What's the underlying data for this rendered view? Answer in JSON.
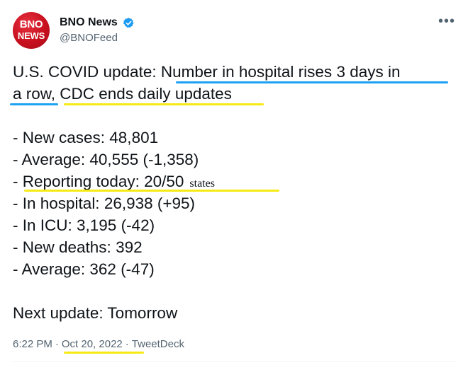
{
  "author": {
    "name": "BNO News",
    "handle": "@BNOFeed",
    "avatar_line1": "BNO",
    "avatar_line2": "NEWS",
    "verified_icon": "verified-badge-icon"
  },
  "more_icon": "more-horizontal-icon",
  "tweet": {
    "headline_part1": "U.S. COVID update: Number in hospital rises 3 days in",
    "headline_part2": "a row, CDC ends daily updates",
    "lines": [
      "- New cases: 48,801",
      "- Average: 40,555 (-1,358)",
      "- Reporting today: 20/50",
      "- In hospital: 26,938 (+95)",
      "- In ICU: 3,195 (-42)",
      "- New deaths: 392",
      "- Average: 362 (-47)"
    ],
    "reporting_note": "states",
    "next_update": "Next update: Tomorrow"
  },
  "footer": {
    "time": "6:22 PM",
    "date": "Oct 20, 2022",
    "source": "TweetDeck",
    "separator": "·"
  },
  "colors": {
    "highlight_blue": "#1da1f2",
    "highlight_yellow": "#f6ea15",
    "avatar_red": "#c8101f",
    "verified_blue": "#1d9bf0"
  }
}
